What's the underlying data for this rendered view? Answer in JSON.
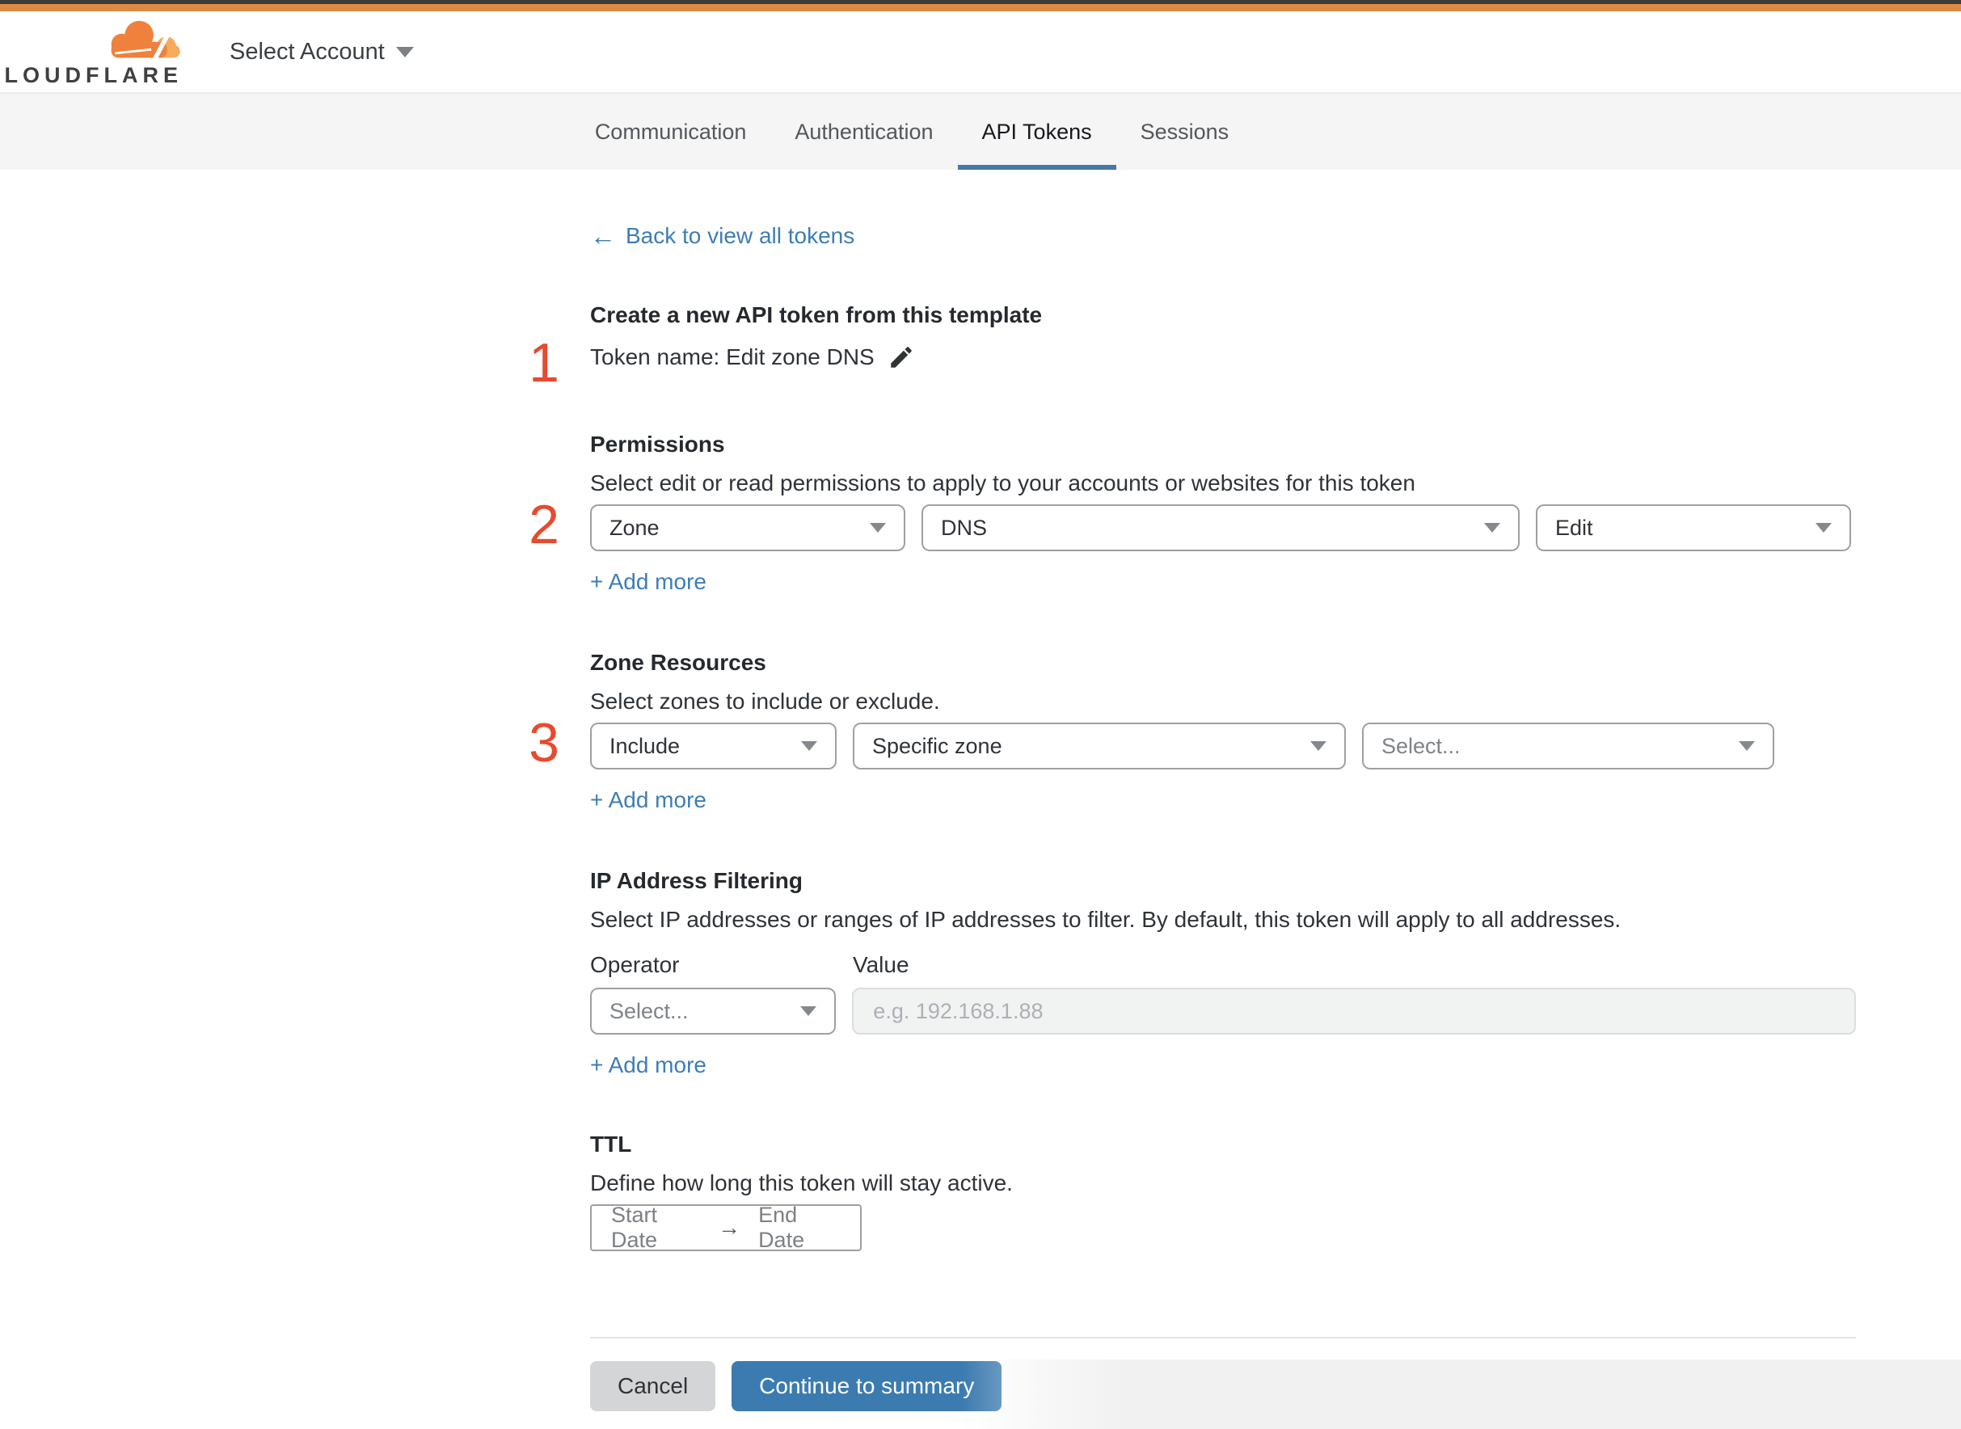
{
  "header": {
    "logo_text": "CLOUDFLARE",
    "account_selector_label": "Select Account"
  },
  "tabs": [
    {
      "label": "Communication",
      "active": false
    },
    {
      "label": "Authentication",
      "active": false
    },
    {
      "label": "API Tokens",
      "active": true
    },
    {
      "label": "Sessions",
      "active": false
    }
  ],
  "back": {
    "arrow_glyph": "←",
    "label": "Back to view all tokens"
  },
  "steps": {
    "template": {
      "number": "1",
      "heading": "Create a new API token from this template",
      "token_name": "Token name: Edit zone DNS"
    },
    "permissions": {
      "number": "2",
      "heading": "Permissions",
      "description": "Select edit or read permissions to apply to your accounts or websites for this token",
      "scope_value": "Zone",
      "resource_value": "DNS",
      "access_value": "Edit",
      "add_more_label": "+ Add more"
    },
    "zone_resources": {
      "number": "3",
      "heading": "Zone Resources",
      "description": "Select zones to include or exclude.",
      "mode_value": "Include",
      "type_value": "Specific zone",
      "zone_placeholder": "Select...",
      "add_more_label": "+ Add more"
    },
    "ip_filtering": {
      "heading": "IP Address Filtering",
      "description": "Select IP addresses or ranges of IP addresses to filter. By default, this token will apply to all addresses.",
      "operator_label": "Operator",
      "value_label": "Value",
      "operator_placeholder": "Select...",
      "value_placeholder": "e.g. 192.168.1.88",
      "add_more_label": "+ Add more"
    },
    "ttl": {
      "heading": "TTL",
      "description": "Define how long this token will stay active.",
      "start_placeholder": "Start Date",
      "arrow_glyph": "→",
      "end_placeholder": "End Date"
    }
  },
  "footer": {
    "cancel_label": "Cancel",
    "continue_label": "Continue to summary"
  },
  "colors": {
    "top_bar_orange": "#de8a43",
    "logo_orange": "#f0813c",
    "logo_orange_light": "#f6ab5e",
    "link_blue": "#3e7db5",
    "button_blue": "#3b7bb0",
    "tab_underline_blue": "#4878a8",
    "step_number_red": "#e74a2f",
    "tabbar_background": "#f5f5f6"
  }
}
